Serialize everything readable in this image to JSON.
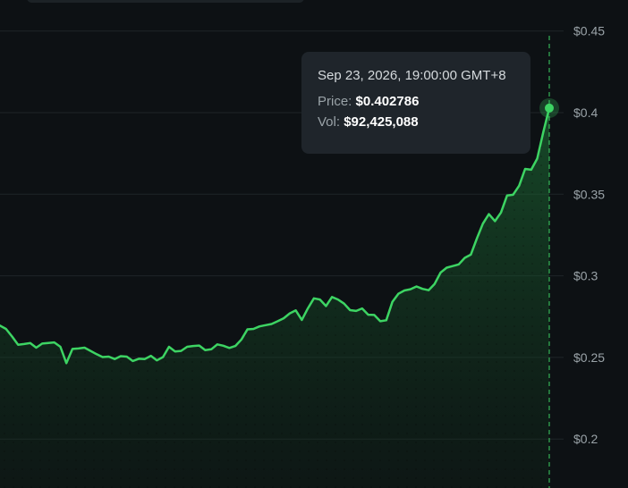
{
  "colors": {
    "background": "#0d1114",
    "line": "#3dd463",
    "grid": "#1f2528",
    "tick_text": "#9aa3a8",
    "tooltip_bg": "#1f252b",
    "crosshair": "#3dd463"
  },
  "tooltip": {
    "date": "Sep 23, 2026, 19:00:00 GMT+8",
    "price_label": "Price:",
    "price_value": "$0.402786",
    "vol_label": "Vol:",
    "vol_value": "$92,425,088"
  },
  "chart_data": {
    "type": "area",
    "y_axis_side": "right",
    "yticks": [
      {
        "value": 0.45,
        "label": "$0.45"
      },
      {
        "value": 0.4,
        "label": "$0.4"
      },
      {
        "value": 0.35,
        "label": "$0.35"
      },
      {
        "value": 0.3,
        "label": "$0.3"
      },
      {
        "value": 0.25,
        "label": "$0.25"
      },
      {
        "value": 0.2,
        "label": "$0.2"
      }
    ],
    "ylim": [
      0.17,
      0.469
    ],
    "grid": true,
    "values": [
      0.2695,
      0.2675,
      0.2628,
      0.2578,
      0.2582,
      0.2588,
      0.256,
      0.2585,
      0.2588,
      0.2592,
      0.2565,
      0.2465,
      0.2552,
      0.2555,
      0.256,
      0.254,
      0.252,
      0.2502,
      0.2505,
      0.249,
      0.2508,
      0.2505,
      0.2478,
      0.2492,
      0.249,
      0.251,
      0.2482,
      0.2502,
      0.2565,
      0.2537,
      0.254,
      0.2565,
      0.257,
      0.2573,
      0.2545,
      0.255,
      0.258,
      0.2572,
      0.2558,
      0.257,
      0.261,
      0.2672,
      0.2675,
      0.269,
      0.2698,
      0.2705,
      0.2722,
      0.274,
      0.277,
      0.2788,
      0.273,
      0.28,
      0.2862,
      0.2855,
      0.2815,
      0.287,
      0.2855,
      0.283,
      0.279,
      0.2785,
      0.28,
      0.2762,
      0.276,
      0.2722,
      0.2728,
      0.284,
      0.289,
      0.291,
      0.2918,
      0.2935,
      0.292,
      0.2912,
      0.295,
      0.302,
      0.305,
      0.306,
      0.307,
      0.311,
      0.313,
      0.3228,
      0.332,
      0.3378,
      0.3335,
      0.3388,
      0.3492,
      0.3497,
      0.3552,
      0.3655,
      0.365,
      0.3718,
      0.388,
      0.4028
    ],
    "highlight": {
      "price": 0.402786,
      "volume": 92425088
    }
  }
}
